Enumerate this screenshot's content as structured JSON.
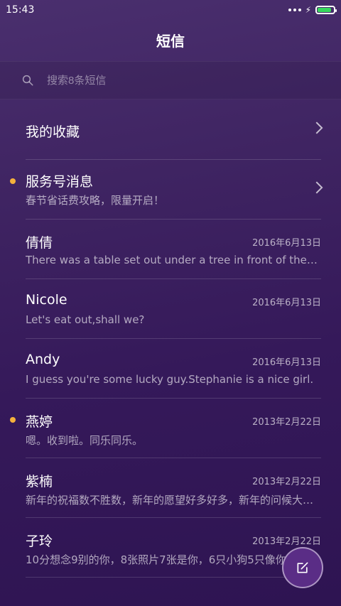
{
  "status": {
    "time": "15:43",
    "battery_color": "#37d95d"
  },
  "header": {
    "title": "短信"
  },
  "search": {
    "placeholder": "搜索8条短信"
  },
  "list": {
    "favorites": {
      "label": "我的收藏"
    },
    "service": {
      "name": "服务号消息",
      "preview": "春节省话费攻略，限量开启！",
      "unread": true
    },
    "items": [
      {
        "name": "倩倩",
        "date": "2016年6月13日",
        "preview": "There was a table set out under a tree in front of the house",
        "unread": false
      },
      {
        "name": "Nicole",
        "date": "2016年6月13日",
        "preview": "Let's eat out,shall we?",
        "unread": false
      },
      {
        "name": "Andy",
        "date": "2016年6月13日",
        "preview": "I guess you're some lucky guy.Stephanie is a nice girl.",
        "unread": false
      },
      {
        "name": "燕婷",
        "date": "2013年2月22日",
        "preview": "嗯。收到啦。同乐同乐。",
        "unread": true
      },
      {
        "name": "紫楠",
        "date": "2013年2月22日",
        "preview": "新年的祝福数不胜数，新年的愿望好多好多，新年的问候大同小异",
        "unread": false
      },
      {
        "name": "子玲",
        "date": "2013年2月22日",
        "preview": "10分想念9别的你，8张照片7张是你，6只小狗5只像你",
        "unread": false
      }
    ]
  },
  "colors": {
    "unread_dot": "#f5b13c",
    "fab": "#5a2d86"
  },
  "icons": {
    "search": "search-icon",
    "chevron": "chevron-right-icon",
    "compose": "compose-icon"
  }
}
